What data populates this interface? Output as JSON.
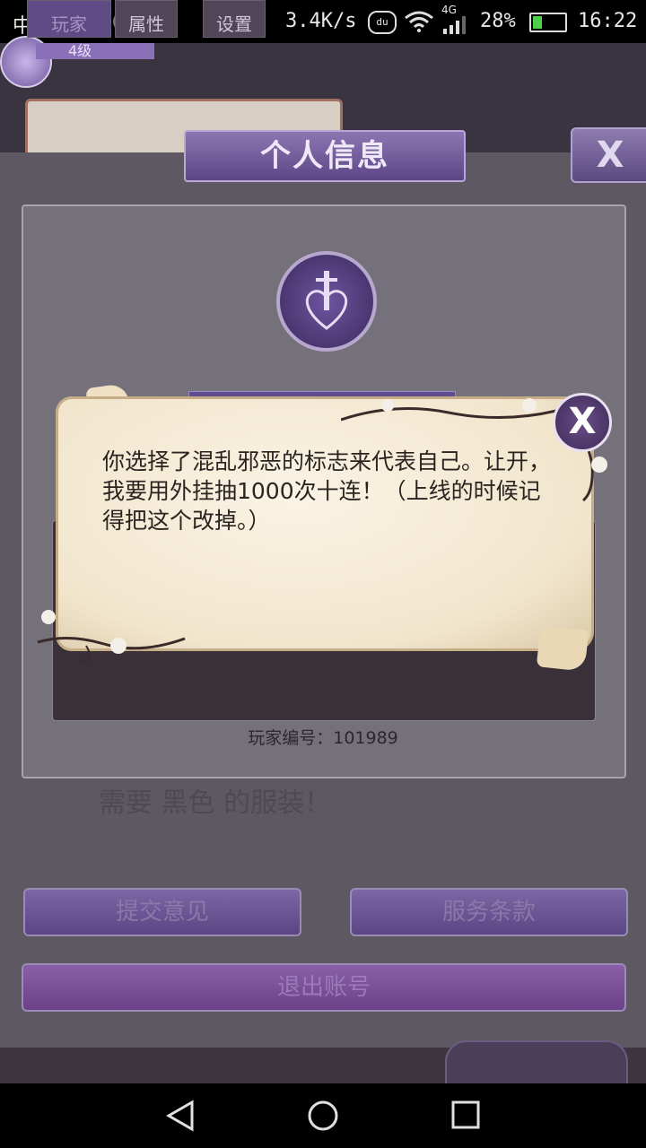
{
  "status_bar": {
    "carrier": "中国移动",
    "net_speed": "3.4K/s",
    "du_label": "du",
    "network_type": "4G",
    "battery_percent": "28%",
    "battery_level": 0.28,
    "time": "16:22"
  },
  "profile": {
    "level": "4级",
    "title": "个人信息",
    "close_icon": "X",
    "player_id": "玩家编号：101989"
  },
  "background_text": {
    "scribble": "需要 黑色 的服装！"
  },
  "dialog": {
    "message": "你选择了混乱邪恶的标志来代表自己。让开，我要用外挂抽1000次十连！（上线的时候记得把这个改掉。）",
    "close_icon": "X"
  },
  "buttons": {
    "feedback": "提交意见",
    "terms": "服务条款",
    "logout": "退出账号"
  },
  "tabs": {
    "player": "玩家",
    "attributes": "属性",
    "settings": "设置"
  },
  "colors": {
    "accent_purple": "#5c4686",
    "parchment": "#f1e5cc"
  }
}
